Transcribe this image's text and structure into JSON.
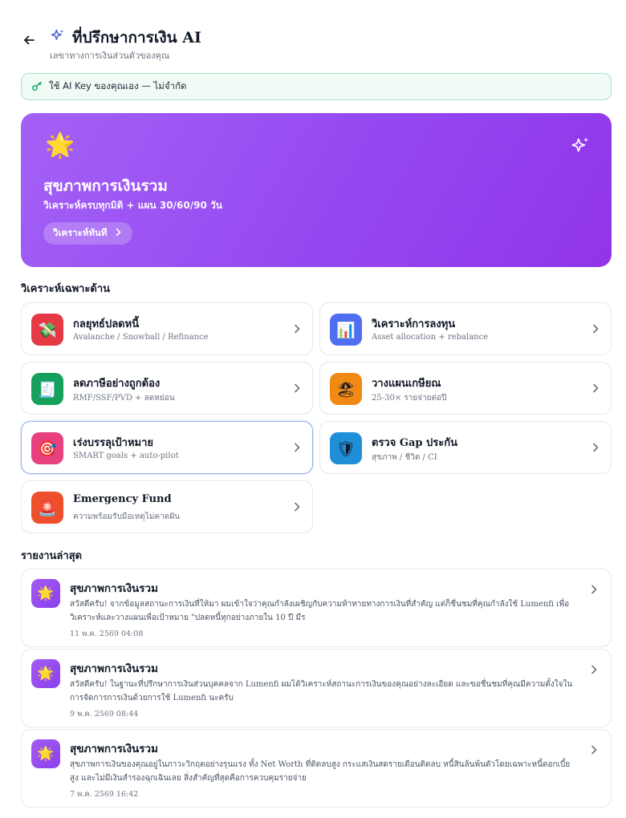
{
  "header": {
    "title": "ที่ปรึกษาการเงิน AI",
    "subtitle": "เลขาทางการเงินส่วนตัวของคุณ",
    "back_icon": "arrow-left-icon",
    "title_icon": "sparkles-icon"
  },
  "key_banner": {
    "icon": "key-icon",
    "text": "ใช้ AI Key ของคุณเอง — ไม่จำกัด"
  },
  "hero": {
    "emoji": "🌟",
    "title": "สุขภาพการเงินรวม",
    "subtitle": "วิเคราะห์ครบทุกมิติ + แผน 30/60/90 วัน",
    "button_label": "วิเคราะห์ทันที",
    "button_icon": "chevron-right-icon",
    "corner_icon": "sparkles-icon",
    "colors": {
      "from": "#a461f6",
      "to": "#9234ea"
    }
  },
  "tools_section": {
    "title": "วิเคราะห์เฉพาะด้าน",
    "items": [
      {
        "name": "กลยุทธ์ปลดหนี้",
        "desc": "Avalanche / Snowball / Refinance",
        "emoji": "💸",
        "color": "#e53945"
      },
      {
        "name": "วิเคราะห์การลงทุน",
        "desc": "Asset allocation + rebalance",
        "emoji": "📊",
        "color": "#4f6ef2"
      },
      {
        "name": "ลดภาษีอย่างถูกต้อง",
        "desc": "RMF/SSF/PVD + ลดหย่อน",
        "emoji": "🧾",
        "color": "#16a05b"
      },
      {
        "name": "วางแผนเกษียณ",
        "desc": "25-30× รายจ่ายต่อปี",
        "emoji": "🏖",
        "color": "#f18a14"
      },
      {
        "name": "เร่งบรรลุเป้าหมาย",
        "desc": "SMART goals + auto-pilot",
        "emoji": "🎯",
        "color": "#e8417f"
      },
      {
        "name": "ตรวจ Gap ประกัน",
        "desc": "สุขภาพ / ชีวิต / CI",
        "emoji": "🛡",
        "color": "#1f8fd8"
      },
      {
        "name": "Emergency Fund",
        "desc": "ความพร้อมรับมือเหตุไม่คาดฝัน",
        "emoji": "🚨",
        "color": "#ee4f2c"
      }
    ]
  },
  "reports_section": {
    "title": "รายงานล่าสุด",
    "items": [
      {
        "title": "สุขภาพการเงินรวม",
        "text": "สวัสดีครับ! จากข้อมูลสถานะการเงินที่ให้มา ผมเข้าใจว่าคุณกำลังเผชิญกับความท้าทายทางการเงินที่สำคัญ แต่ก็ชื่นชมที่คุณกำลังใช้ Lumenfi เพื่อวิเคราะห์และวางแผนเพื่อเป้าหมาย \"ปลดหนี้ทุกอย่างภายใน 10 ปี มีร",
        "date": "11 พ.ค. 2569 04:08",
        "emoji": "🌟"
      },
      {
        "title": "สุขภาพการเงินรวม",
        "text": "สวัสดีครับ! ในฐานะที่ปรึกษาการเงินส่วนบุคคลจาก Lumenfi ผมได้วิเคราะห์สถานะการเงินของคุณอย่างละเอียด และขอชื่นชมที่คุณมีความตั้งใจในการจัดการการเงินด้วยการใช้ Lumenfi นะครับ",
        "date": "9 พ.ค. 2569 08:44",
        "emoji": "🌟"
      },
      {
        "title": "สุขภาพการเงินรวม",
        "text": "สุขภาพการเงินของคุณอยู่ในภาวะวิกฤตอย่างรุนแรง ทั้ง Net Worth ที่ติดลบสูง กระแสเงินสดรายเดือนติดลบ หนี้สินล้นพ้นตัวโดยเฉพาะหนี้ดอกเบี้ยสูง และไม่มีเงินสำรองฉุกเฉินเลย สิ่งสำคัญที่สุดคือการควบคุมรายจ่าย",
        "date": "7 พ.ค. 2569 16:42",
        "emoji": "🌟"
      }
    ]
  }
}
